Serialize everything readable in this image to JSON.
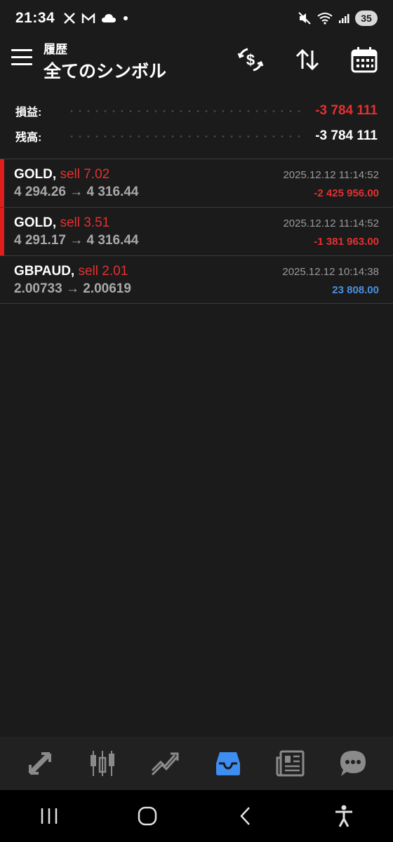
{
  "status_bar": {
    "time": "21:34",
    "left_icons": [
      "x-logo-icon",
      "gmail-icon",
      "cloud-icon",
      "dot-icon"
    ],
    "right_icons": [
      "mute-icon",
      "wifi-icon",
      "signal-icon"
    ],
    "battery": "35"
  },
  "app_bar": {
    "title_small": "履歴",
    "title_large": "全てのシンボル",
    "icons": [
      "currency-exchange-icon",
      "sort-icon",
      "calendar-icon"
    ]
  },
  "summary": {
    "profit_label": "損益:",
    "profit_value": "-3 784 111",
    "balance_label": "残高:",
    "balance_value": "-3 784 111"
  },
  "deals": [
    {
      "symbol": "GOLD,",
      "side": "sell 7.02",
      "prices": "4 294.26 → 4 316.44",
      "time": "2025.12.12 11:14:52",
      "profit": "-2 425 956.00",
      "profit_color": "#e53030",
      "marker": true
    },
    {
      "symbol": "GOLD,",
      "side": "sell 3.51",
      "prices": "4 291.17 → 4 316.44",
      "time": "2025.12.12 11:14:52",
      "profit": "-1 381 963.00",
      "profit_color": "#e53030",
      "marker": true
    },
    {
      "symbol": "GBPAUD,",
      "side": "sell 2.01",
      "prices": "2.00733 → 2.00619",
      "time": "2025.12.12 10:14:38",
      "profit": "23 808.00",
      "profit_color": "#4a90e2",
      "marker": false
    }
  ],
  "bottom_nav": {
    "items": [
      "quotes-icon",
      "chart-icon",
      "trade-icon",
      "history-icon",
      "news-icon",
      "chat-icon"
    ],
    "active": "history-icon",
    "active_color": "#3d8ef0"
  },
  "colors": {
    "loss": "#e53030",
    "profit": "#4a90e2",
    "background": "#1b1b1b"
  }
}
